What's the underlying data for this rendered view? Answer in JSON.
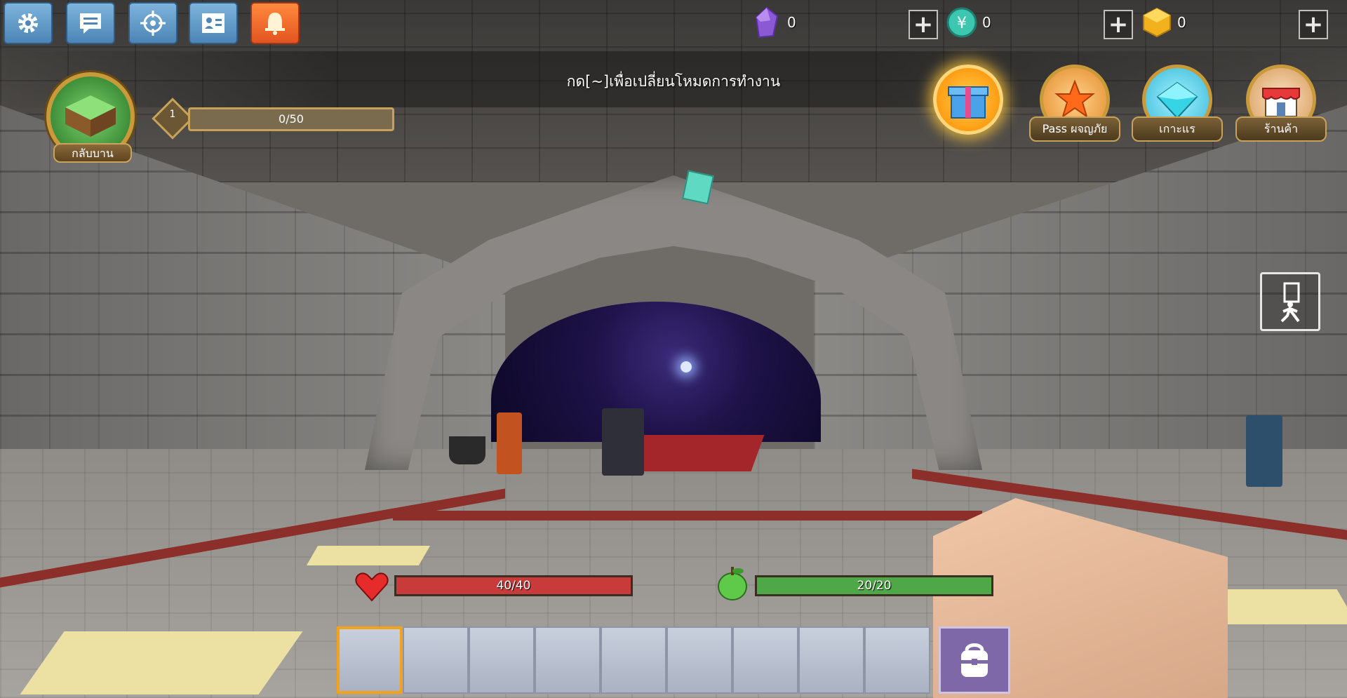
{
  "toolbar": {
    "buttons": [
      {
        "icon": "gear-icon"
      },
      {
        "icon": "chat-icon"
      },
      {
        "icon": "crosshair-icon"
      },
      {
        "icon": "profile-card-icon"
      },
      {
        "icon": "bell-icon"
      }
    ]
  },
  "currencies": [
    {
      "icon": "purple-gem-icon",
      "value": "0"
    },
    {
      "icon": "green-coin-icon",
      "value": "0"
    },
    {
      "icon": "gold-cube-icon",
      "value": "0"
    }
  ],
  "hint": "กด[~]เพื่อเปลี่ยนโหมดการทำงาน",
  "home": {
    "label": "กลับบาน"
  },
  "level": {
    "number": "1",
    "xp_text": "0/50",
    "xp_fraction": 0
  },
  "shortcuts": [
    {
      "icon": "gift-box-icon",
      "label": ""
    },
    {
      "icon": "adventure-pass-icon",
      "label": "Pass ผจญภัย"
    },
    {
      "icon": "island-crystal-icon",
      "label": "เกาะแร"
    },
    {
      "icon": "shop-icon",
      "label": "ร้านค้า"
    }
  ],
  "health": {
    "text": "40/40",
    "fraction": 1.0,
    "color": "#c93a3a"
  },
  "hunger": {
    "text": "20/20",
    "fraction": 1.0,
    "color": "#4fa847"
  },
  "hotbar": {
    "slots": 9,
    "selected_index": 0
  },
  "colors": {
    "button_blue": "#5a93c4",
    "alert_orange": "#ef6a2a",
    "gold_border": "#c7a25a"
  }
}
